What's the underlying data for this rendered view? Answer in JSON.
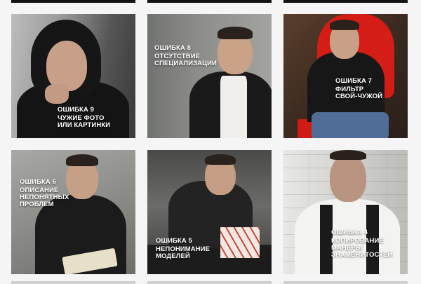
{
  "tiles": [
    {
      "id": 9,
      "mistake_num": "ОШИБКА 9",
      "lines": [
        "ЧУЖИЕ ФОТО",
        "ИЛИ КАРТИНКИ"
      ]
    },
    {
      "id": 8,
      "mistake_num": "ОШИБКА 8",
      "lines": [
        "ОТСУТСТВИЕ",
        "СПЕЦИАЛИЗАЦИИ"
      ]
    },
    {
      "id": 7,
      "mistake_num": "ОШИБКА 7",
      "lines": [
        "ФИЛЬТР",
        "СВОЙ-ЧУЖОЙ"
      ]
    },
    {
      "id": 6,
      "mistake_num": "ОШИБКА 6",
      "lines": [
        "ОПИСАНИЕ",
        "НЕПОНЯТНЫХ",
        "ПРОБЛЕМ"
      ]
    },
    {
      "id": 5,
      "mistake_num": "ОШИБКА 5",
      "lines": [
        "НЕПОНИМАНИЕ",
        "МОДЕЛЕЙ"
      ]
    },
    {
      "id": 4,
      "mistake_num": "ОШИБКА 4",
      "lines": [
        "КОПИРОВАНИЕ",
        "МАНЕРЫ",
        "ЗНАМЕНИТОСТЕЙ"
      ]
    }
  ]
}
